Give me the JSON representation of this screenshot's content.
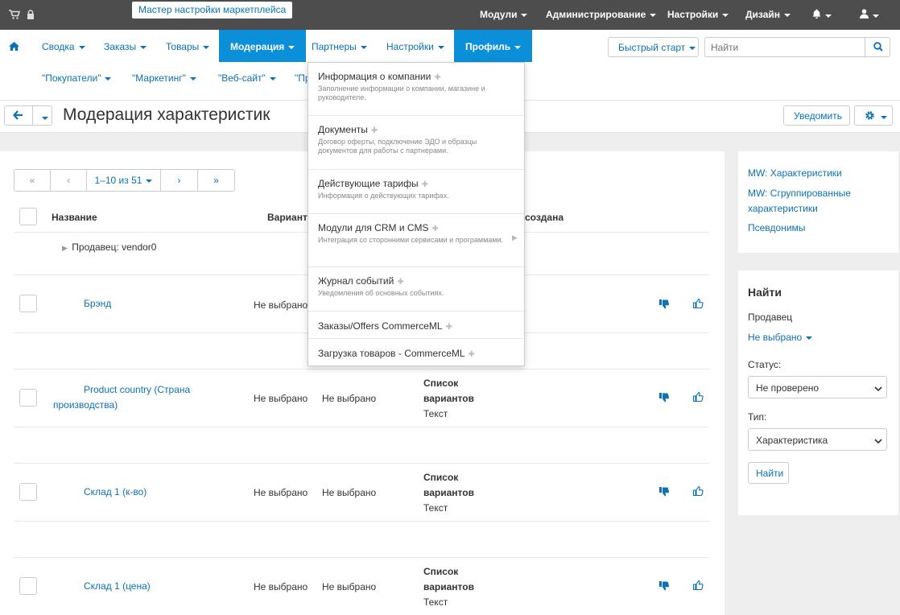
{
  "topbar": {
    "wizard_label": "Мастер настройки маркетплейса",
    "menus": [
      "Модули",
      "Администрирование",
      "Настройки",
      "Дизайн"
    ]
  },
  "navbar": {
    "items": [
      "Сводка",
      "Заказы",
      "Товары",
      "Модерация",
      "Партнеры",
      "Настройки",
      "Профиль"
    ],
    "active_item": "Модерация",
    "open_item": "Профиль",
    "subitems": [
      "\"Покупатели\"",
      "\"Маркетинг\"",
      "\"Веб-сайт\"",
      "\"Пр"
    ],
    "quickstart_label": "Быстрый старт",
    "search_placeholder": "Найти"
  },
  "titlebar": {
    "title": "Модерация характеристик",
    "notify_label": "Уведомить"
  },
  "pager": {
    "first": "«",
    "prev": "‹",
    "range": "1–10 из 51",
    "next": "›",
    "last": "»"
  },
  "table": {
    "headers": [
      "Название",
      "Варианты",
      "создана"
    ],
    "group_label": "Продавец: vendor0",
    "rows": [
      {
        "name": "Брэнд",
        "col1": "Не выбрано",
        "col2": "",
        "type_line1": "",
        "type_line2": "",
        "type_line3": ""
      },
      {
        "name": "Product country (Страна производства)",
        "col1": "Не выбрано",
        "col2": "Не выбрано",
        "type_line1": "Список",
        "type_line2": "вариантов",
        "type_line3": "Текст"
      },
      {
        "name": "Склад 1 (к-во)",
        "col1": "Не выбрано",
        "col2": "Не выбрано",
        "type_line1": "Список",
        "type_line2": "вариантов",
        "type_line3": "Текст"
      },
      {
        "name": "Склад 1 (цена)",
        "col1": "Не выбрано",
        "col2": "Не выбрано",
        "type_line1": "Список",
        "type_line2": "вариантов",
        "type_line3": "Текст"
      }
    ]
  },
  "sidebar": {
    "links": [
      "MW: Характеристики",
      "MW: Сгруппированные характеристики",
      "Псевдонимы"
    ],
    "search_title": "Найти",
    "seller_label": "Продавец",
    "seller_value": "Не выбрано",
    "status_label": "Статус:",
    "status_value": "Не проверено",
    "type_label": "Тип:",
    "type_value": "Характеристика",
    "find_button": "Найти"
  },
  "dropdown": {
    "items": [
      {
        "title": "Информация о компании",
        "desc": "Заполнение информации о компании, магазине и руководителе."
      },
      {
        "title": "Документы",
        "desc": "Договор оферты, подключение ЭДО и образцы документов для работы с партнерами."
      },
      {
        "title": "Действующие тарифы",
        "desc": "Информация о действующих тарифах."
      },
      {
        "title": "Модули для CRM и CMS",
        "desc": "Интеграция со сторонними сервисами и программами."
      },
      {
        "title": "Журнал событий",
        "desc": "Уведомления об основных событиях."
      },
      {
        "title": "Заказы/Offers CommerceML",
        "desc": ""
      },
      {
        "title": "Загрузка товаров - CommerceML",
        "desc": ""
      }
    ]
  },
  "colors": {
    "accent": "#0b8fd9",
    "link": "#0b72b5",
    "topbar": "#4d4d4d"
  }
}
